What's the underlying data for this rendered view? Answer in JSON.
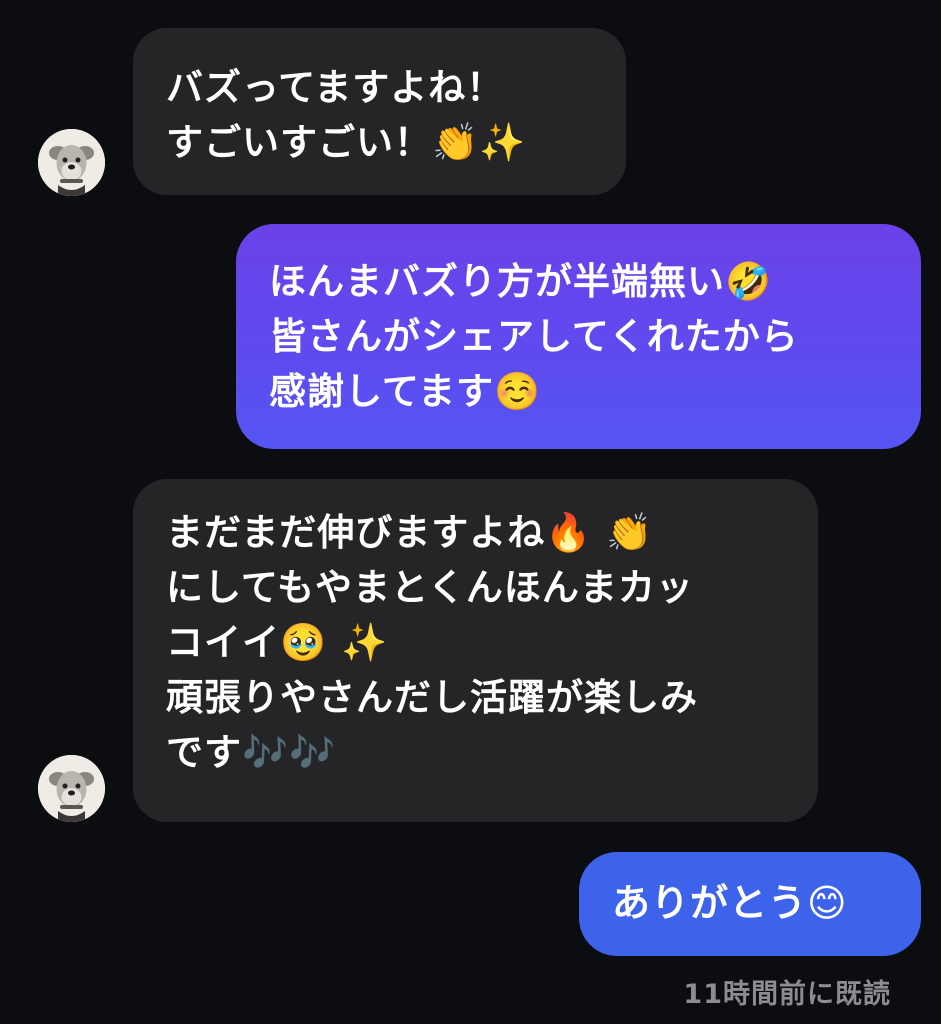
{
  "messages": [
    {
      "direction": "incoming",
      "lines": [
        "バズってますよね！",
        "すごいすごい！👏✨"
      ]
    },
    {
      "direction": "outgoing",
      "lines": [
        "ほんまバズり方が半端無い🤣",
        "皆さんがシェアしてくれたから",
        "感謝してます☺️"
      ]
    },
    {
      "direction": "incoming",
      "lines": [
        "まだまだ伸びますよね🔥 👏",
        "にしてもやまとくんほんまカッ",
        "コイイ🥹 ✨",
        "頑張りやさんだし活躍が楽しみ",
        "です🎶🎶"
      ]
    },
    {
      "direction": "outgoing",
      "lines": [
        "ありがとう😊"
      ]
    }
  ],
  "avatar": {
    "icon": "dog-avatar-icon"
  },
  "read_receipt": "11時間前に既読",
  "colors": {
    "background": "#0c0d10",
    "incoming_bubble": "#252528",
    "outgoing_gradient_start": "#6a42e8",
    "outgoing_gradient_end": "#5555f2",
    "outgoing_bubble_blue": "#3d63ea",
    "read_receipt_text": "#8c8c91"
  }
}
